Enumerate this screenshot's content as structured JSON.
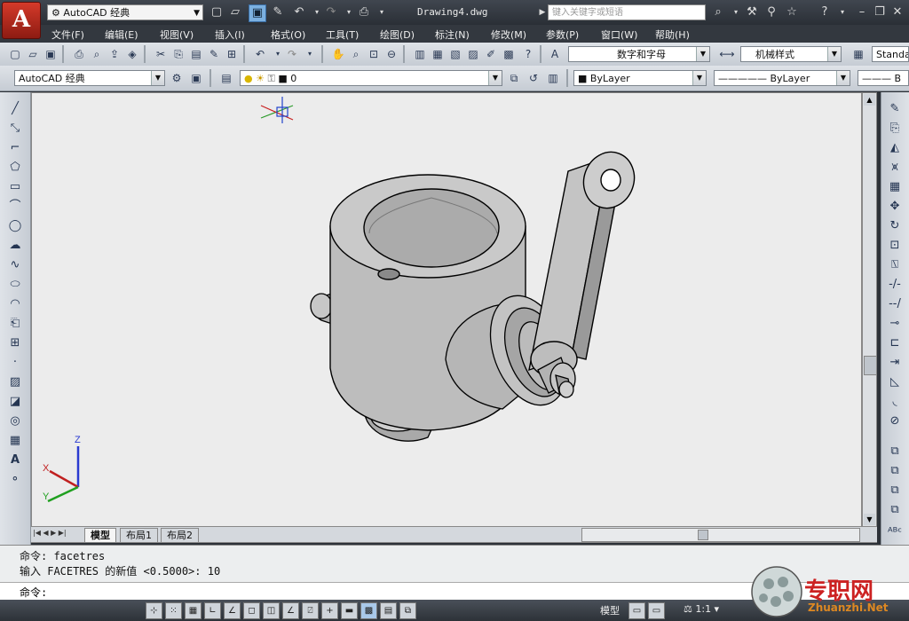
{
  "titlebar": {
    "app_logo": "A",
    "workspace": "AutoCAD 经典",
    "doc_title": "Drawing4.dwg",
    "search_placeholder": "键入关键字或短语"
  },
  "menu": [
    "文件(F)",
    "编辑(E)",
    "视图(V)",
    "插入(I)",
    "格式(O)",
    "工具(T)",
    "绘图(D)",
    "标注(N)",
    "修改(M)",
    "参数(P)",
    "窗口(W)",
    "帮助(H)"
  ],
  "toolbar1": {
    "text_style": "数字和字母",
    "dim_style": "机械样式",
    "table_style": "Standa"
  },
  "toolbar2": {
    "workspace": "AutoCAD 经典",
    "layer": "0",
    "color": "ByLayer",
    "linetype": "ByLayer",
    "lineweight": "B"
  },
  "tabs": [
    "模型",
    "布局1",
    "布局2"
  ],
  "command": {
    "line1": "命令: facetres",
    "line2": "输入 FACETRES 的新值 <0.5000>: 10",
    "prompt": "命令:"
  },
  "status": {
    "model": "模型",
    "scale": "1:1"
  },
  "ucs": {
    "x": "X",
    "y": "Y",
    "z": "Z"
  },
  "watermark": {
    "text": "专职网",
    "url": "Zhuanzhi.Net"
  },
  "colors": {
    "accent_red": "#c0392b",
    "title_bg": "#2f343b",
    "canvas_bg": "#ececec"
  }
}
